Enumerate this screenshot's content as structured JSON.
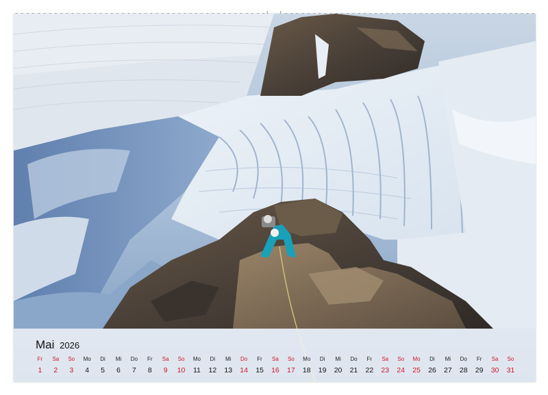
{
  "calendar": {
    "month": "Mai",
    "year": "2026",
    "days": [
      {
        "wd": "Fr",
        "d": "1",
        "we": true
      },
      {
        "wd": "Sa",
        "d": "2",
        "we": true
      },
      {
        "wd": "So",
        "d": "3",
        "we": true
      },
      {
        "wd": "Mo",
        "d": "4",
        "we": false
      },
      {
        "wd": "Di",
        "d": "5",
        "we": false
      },
      {
        "wd": "Mi",
        "d": "6",
        "we": false
      },
      {
        "wd": "Do",
        "d": "7",
        "we": false
      },
      {
        "wd": "Fr",
        "d": "8",
        "we": false
      },
      {
        "wd": "Sa",
        "d": "9",
        "we": true
      },
      {
        "wd": "So",
        "d": "10",
        "we": true
      },
      {
        "wd": "Mo",
        "d": "11",
        "we": false
      },
      {
        "wd": "Di",
        "d": "12",
        "we": false
      },
      {
        "wd": "Mi",
        "d": "13",
        "we": false
      },
      {
        "wd": "Do",
        "d": "14",
        "we": true
      },
      {
        "wd": "Fr",
        "d": "15",
        "we": false
      },
      {
        "wd": "Sa",
        "d": "16",
        "we": true
      },
      {
        "wd": "So",
        "d": "17",
        "we": true
      },
      {
        "wd": "Mo",
        "d": "18",
        "we": false
      },
      {
        "wd": "Di",
        "d": "19",
        "we": false
      },
      {
        "wd": "Mi",
        "d": "20",
        "we": false
      },
      {
        "wd": "Do",
        "d": "21",
        "we": false
      },
      {
        "wd": "Fr",
        "d": "22",
        "we": false
      },
      {
        "wd": "Sa",
        "d": "23",
        "we": true
      },
      {
        "wd": "So",
        "d": "24",
        "we": true
      },
      {
        "wd": "Mo",
        "d": "25",
        "we": true
      },
      {
        "wd": "Di",
        "d": "26",
        "we": false
      },
      {
        "wd": "Mi",
        "d": "27",
        "we": false
      },
      {
        "wd": "Do",
        "d": "28",
        "we": false
      },
      {
        "wd": "Fr",
        "d": "29",
        "we": false
      },
      {
        "wd": "Sa",
        "d": "30",
        "we": true
      },
      {
        "wd": "So",
        "d": "31",
        "we": true
      }
    ]
  },
  "colors": {
    "holiday_red": "#d2142a",
    "regular_text": "#111111"
  }
}
